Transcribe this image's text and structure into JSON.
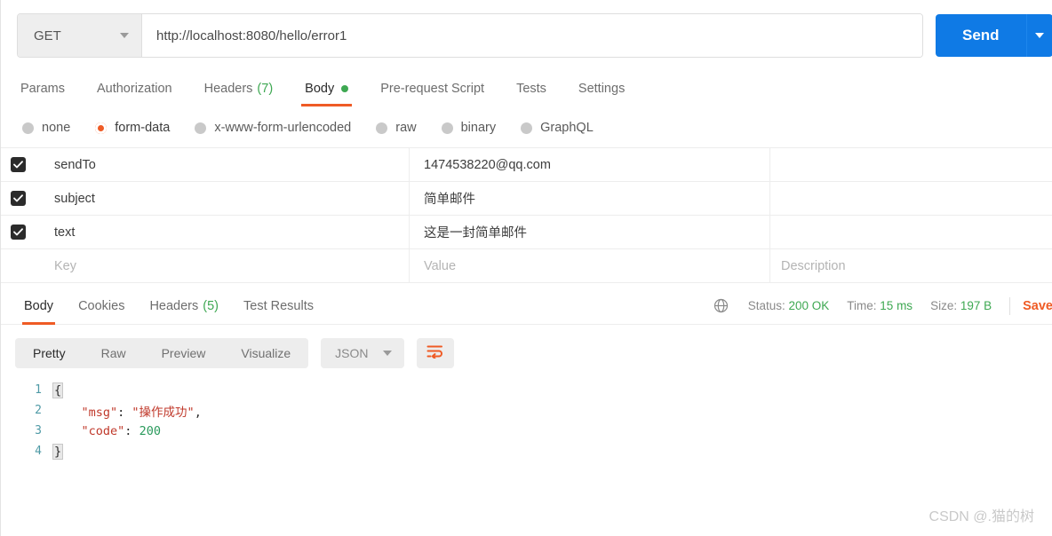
{
  "request": {
    "method": "GET",
    "url": "http://localhost:8080/hello/error1",
    "send_label": "Send",
    "tabs": [
      {
        "label": "Params",
        "count": "",
        "active": false,
        "dot": false
      },
      {
        "label": "Authorization",
        "count": "",
        "active": false,
        "dot": false
      },
      {
        "label": "Headers",
        "count": "(7)",
        "active": false,
        "dot": false
      },
      {
        "label": "Body",
        "count": "",
        "active": true,
        "dot": true
      },
      {
        "label": "Pre-request Script",
        "count": "",
        "active": false,
        "dot": false
      },
      {
        "label": "Tests",
        "count": "",
        "active": false,
        "dot": false
      },
      {
        "label": "Settings",
        "count": "",
        "active": false,
        "dot": false
      }
    ],
    "body_types": [
      {
        "label": "none",
        "selected": false
      },
      {
        "label": "form-data",
        "selected": true
      },
      {
        "label": "x-www-form-urlencoded",
        "selected": false
      },
      {
        "label": "raw",
        "selected": false
      },
      {
        "label": "binary",
        "selected": false
      },
      {
        "label": "GraphQL",
        "selected": false
      }
    ],
    "form_data": {
      "placeholders": {
        "key": "Key",
        "value": "Value",
        "description": "Description"
      },
      "rows": [
        {
          "checked": true,
          "key": "sendTo",
          "value": "1474538220@qq.com",
          "description": ""
        },
        {
          "checked": true,
          "key": "subject",
          "value": "简单邮件",
          "description": ""
        },
        {
          "checked": true,
          "key": "text",
          "value": "这是一封简单邮件",
          "description": ""
        }
      ]
    }
  },
  "response": {
    "tabs": [
      {
        "label": "Body",
        "count": "",
        "active": true
      },
      {
        "label": "Cookies",
        "count": "",
        "active": false
      },
      {
        "label": "Headers",
        "count": "(5)",
        "active": false
      },
      {
        "label": "Test Results",
        "count": "",
        "active": false
      }
    ],
    "status": {
      "status_label": "Status:",
      "status_value": "200 OK",
      "time_label": "Time:",
      "time_value": "15 ms",
      "size_label": "Size:",
      "size_value": "197 B"
    },
    "save_label": "Save",
    "view_modes": [
      {
        "label": "Pretty",
        "active": true
      },
      {
        "label": "Raw",
        "active": false
      },
      {
        "label": "Preview",
        "active": false
      },
      {
        "label": "Visualize",
        "active": false
      }
    ],
    "format": "JSON",
    "code": {
      "lines": [
        {
          "n": "1",
          "brace_open": "{",
          "indent": "",
          "key": "",
          "sep": "",
          "value": "",
          "value_type": "",
          "comma": ""
        },
        {
          "n": "2",
          "brace_open": "",
          "indent": "    ",
          "key": "\"msg\"",
          "sep": ": ",
          "value": "\"操作成功\"",
          "value_type": "string",
          "comma": ","
        },
        {
          "n": "3",
          "brace_open": "",
          "indent": "    ",
          "key": "\"code\"",
          "sep": ": ",
          "value": "200",
          "value_type": "number",
          "comma": ""
        },
        {
          "n": "4",
          "brace_open": "}",
          "indent": "",
          "key": "",
          "sep": "",
          "value": "",
          "value_type": "",
          "comma": ""
        }
      ]
    }
  },
  "watermark": "CSDN @.猫的树",
  "colors": {
    "accent_orange": "#ef5b25",
    "send_blue": "#0f7ae5",
    "status_green": "#3ea852"
  }
}
